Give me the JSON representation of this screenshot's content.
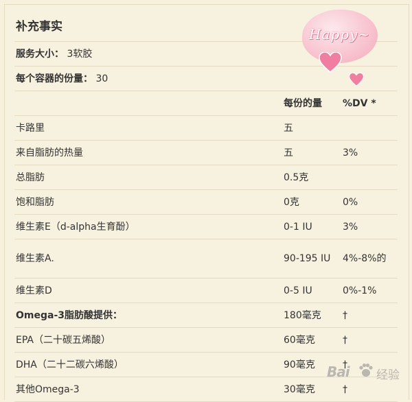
{
  "title": "补充事实",
  "serving_size": {
    "label": "服务大小：",
    "value": "3软胶"
  },
  "servings_per_container": {
    "label": "每个容器的份量：",
    "value": "30"
  },
  "header": {
    "amount": "每份的量",
    "dv": "%DV *"
  },
  "rows": [
    {
      "name": "卡路里",
      "amount": "五",
      "dv": "",
      "bold": false
    },
    {
      "name": "来自脂肪的热量",
      "amount": "五",
      "dv": "3%",
      "bold": false
    },
    {
      "name": "总脂肪",
      "amount": "0.5克",
      "dv": "",
      "bold": false
    },
    {
      "name": "饱和脂肪",
      "amount": "0克",
      "dv": "0%",
      "bold": false
    },
    {
      "name": "维生素E（d-alpha生育酚）",
      "amount": "0-1 IU",
      "dv": "3%",
      "bold": false
    },
    {
      "name": "维生素A.",
      "amount": "90-195 IU",
      "dv": "4%-8%的",
      "bold": false
    },
    {
      "name": "维生素D",
      "amount": "0-5 IU",
      "dv": "0%-1%",
      "bold": false
    },
    {
      "name": "Omega-3脂肪酸提供：",
      "amount": "180毫克",
      "dv": "†",
      "bold": true
    },
    {
      "name": "EPA（二十碳五烯酸）",
      "amount": "60毫克",
      "dv": "†",
      "bold": false
    },
    {
      "name": "DHA（二十二碳六烯酸）",
      "amount": "90毫克",
      "dv": "†",
      "bold": false
    },
    {
      "name": "其他Omega-3",
      "amount": "30毫克",
      "dv": "†",
      "bold": false
    }
  ],
  "sticker": {
    "text": "Happy~",
    "icon": "heart-icon",
    "color": "#f08aa8"
  },
  "watermark": {
    "brand": "Bai",
    "text": "经验",
    "icon": "paw-icon"
  }
}
